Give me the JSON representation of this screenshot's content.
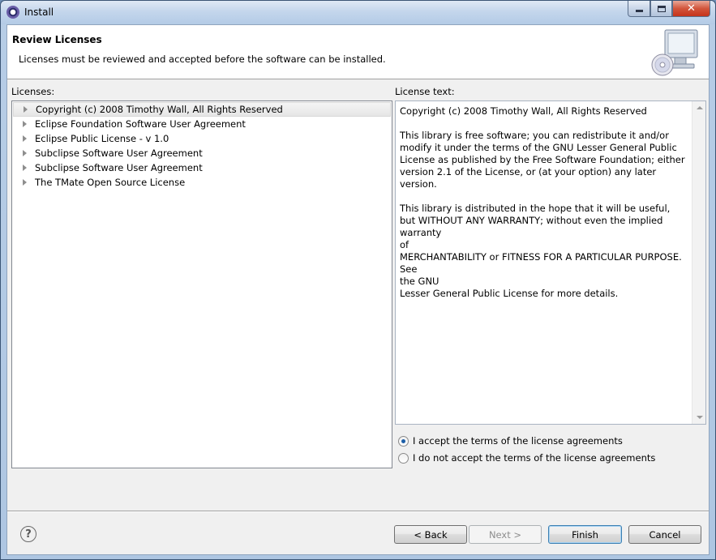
{
  "window": {
    "title": "Install"
  },
  "header": {
    "title": "Review Licenses",
    "description": "Licenses must be reviewed and accepted before the software can be installed."
  },
  "licenses": {
    "label": "Licenses:",
    "items": [
      {
        "label": "Copyright (c) 2008 Timothy Wall, All Rights Reserved",
        "selected": true
      },
      {
        "label": "Eclipse Foundation Software User Agreement",
        "selected": false
      },
      {
        "label": "Eclipse Public License - v 1.0",
        "selected": false
      },
      {
        "label": "Subclipse Software User Agreement",
        "selected": false
      },
      {
        "label": "Subclipse Software User Agreement",
        "selected": false
      },
      {
        "label": "The TMate Open Source License",
        "selected": false
      }
    ]
  },
  "license_text": {
    "label": "License text:",
    "content": "Copyright (c) 2008 Timothy Wall, All Rights Reserved\n\nThis library is free software; you can redistribute it and/or\nmodify it under the terms of the GNU Lesser General Public\nLicense as published by the Free Software Foundation; either\nversion 2.1 of the License, or (at your option) any later version.\n\nThis library is distributed in the hope that it will be useful,\nbut WITHOUT ANY WARRANTY; without even the implied warranty\nof\nMERCHANTABILITY or FITNESS FOR A PARTICULAR PURPOSE.  See\nthe GNU\nLesser General Public License for more details."
  },
  "acceptance": {
    "accept_label": "I accept the terms of the license agreements",
    "decline_label": "I do not accept the terms of the license agreements",
    "selected": "accept"
  },
  "buttons": {
    "back": "< Back",
    "next": "Next >",
    "finish": "Finish",
    "cancel": "Cancel"
  },
  "icons": {
    "help": "help-icon",
    "header_art": "install-computer-cd-icon"
  },
  "colors": {
    "selection_accent": "#1d5fa8",
    "close_button": "#c5331a"
  }
}
